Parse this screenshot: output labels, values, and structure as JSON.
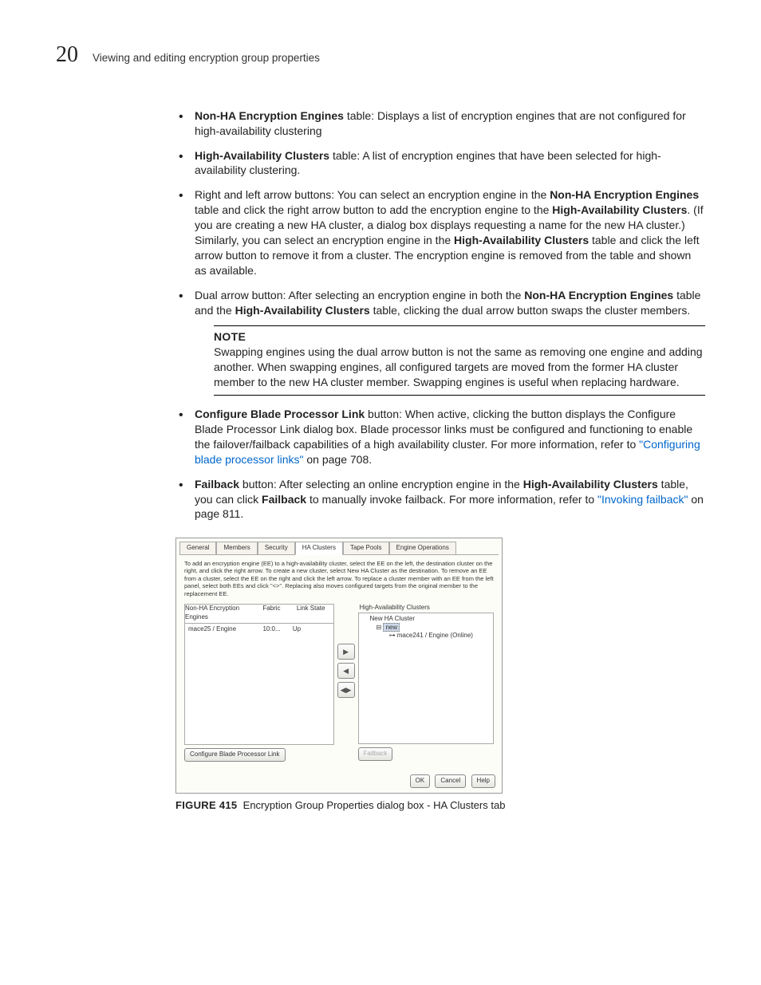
{
  "header": {
    "chapterNumber": "20",
    "chapterTitle": "Viewing and editing encryption group properties"
  },
  "bullets": {
    "b1_bold": "Non-HA Encryption Engines",
    "b1_rest": " table: Displays a list of encryption engines that are not configured for high-availability clustering",
    "b2_bold": "High-Availability Clusters",
    "b2_rest": " table: A list of encryption engines that have been selected for high-availability clustering.",
    "b3_a": "Right and left arrow buttons: You can select an encryption engine in the ",
    "b3_bold1": "Non-HA Encryption Engines",
    "b3_b": " table and click the right arrow button to add the encryption engine to the ",
    "b3_bold2": "High-Availability Clusters",
    "b3_c": ". (If you are creating a new HA cluster, a dialog box displays requesting a name for the new HA cluster.) Similarly, you can select an encryption engine in the ",
    "b3_bold3": "High-Availability Clusters",
    "b3_d": " table and click the left arrow button to remove it from a cluster. The encryption engine is removed from the table and shown as available.",
    "b4_a": "Dual arrow button: After selecting an encryption engine in both the ",
    "b4_bold1": "Non-HA Encryption Engines",
    "b4_b": " table and the ",
    "b4_bold2": "High-Availability Clusters",
    "b4_c": " table, clicking the dual arrow button swaps the cluster members.",
    "b5_bold": "Configure Blade Processor Link",
    "b5_a": " button: When active, clicking the button displays the Configure Blade Processor Link dialog box. Blade processor links must be configured and functioning to enable the failover/failback capabilities of a high availability cluster. For more information, refer to ",
    "b5_link": "\"Configuring blade processor links\"",
    "b5_b": " on page 708.",
    "b6_bold": "Failback",
    "b6_a": " button: After selecting an online encryption engine in the ",
    "b6_bold2": "High-Availability Clusters",
    "b6_b": " table, you can click ",
    "b6_bold3": "Failback",
    "b6_c": " to manually invoke failback. For more information, refer to ",
    "b6_link": "\"Invoking failback\"",
    "b6_d": " on page 811."
  },
  "note": {
    "label": "NOTE",
    "text": "Swapping engines using the dual arrow button is not the same as removing one engine and adding another. When swapping engines, all configured targets are moved from the former HA cluster member to the new HA cluster member. Swapping engines is useful when replacing hardware."
  },
  "dialog": {
    "tabs": [
      "General",
      "Members",
      "Security",
      "HA Clusters",
      "Tape Pools",
      "Engine Operations"
    ],
    "instructions": "To add an encryption engine (EE) to a high-availability cluster, select the EE on the left, the destination cluster on the right, and click the right arrow. To create a new cluster, select New HA Cluster as the destination. To remove an EE from a cluster, select the EE on the right and click the left arrow. To replace a cluster member with an EE from the left panel, select both EEs and click \"<>\". Replacing also moves configured targets from the original member to the replacement EE.",
    "leftHeader": [
      "Non-HA Encryption Engines",
      "Fabric",
      "Link State"
    ],
    "leftRow": [
      "mace25 / Engine",
      "10:0...",
      "Up"
    ],
    "rightHeader": "High-Availability Clusters",
    "tree1": "New HA Cluster",
    "tree2": "new",
    "tree3": "mace241 / Engine (Online)",
    "configBtn": "Configure Blade Processor Link",
    "failbackBtn": "Failback",
    "bottom": [
      "OK",
      "Cancel",
      "Help"
    ]
  },
  "figure": {
    "label": "FIGURE 415",
    "caption": "Encryption Group Properties dialog box - HA Clusters tab"
  }
}
